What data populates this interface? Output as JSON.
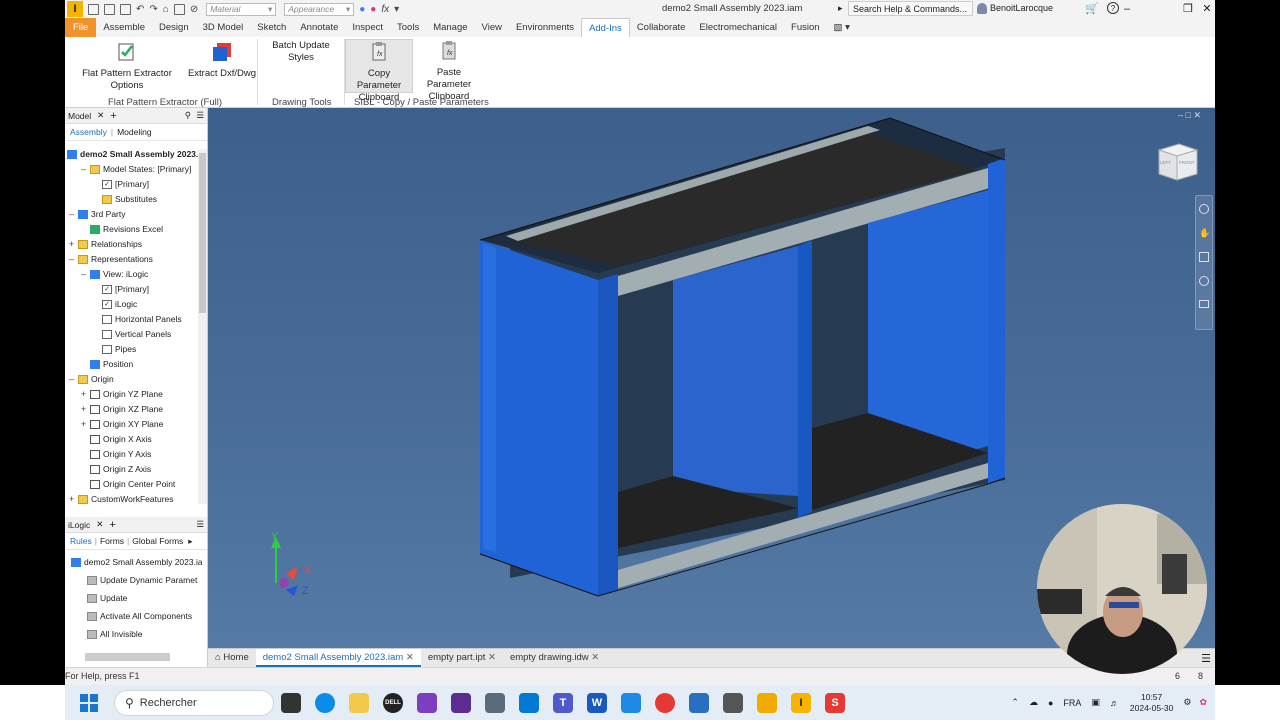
{
  "window": {
    "document_title": "demo2 Small Assembly 2023.iam",
    "search_placeholder": "Search Help & Commands...",
    "user_name": "BenoitLarocque",
    "material_combo": "Material",
    "appearance_combo": "Appearance",
    "minimize": "–",
    "restore": "❐",
    "close": "✕",
    "help": "?"
  },
  "ribbon_tabs": [
    "File",
    "Assemble",
    "Design",
    "3D Model",
    "Sketch",
    "Annotate",
    "Inspect",
    "Tools",
    "Manage",
    "View",
    "Environments",
    "Add-Ins",
    "Collaborate",
    "Electromechanical",
    "Fusion"
  ],
  "ribbon_active_tab": "Add-Ins",
  "ribbon": {
    "flat_pattern_options": "Flat Pattern Extractor Options",
    "extract_dxf": "Extract Dxf/Dwg",
    "batch_update": "Batch Update Styles",
    "copy_param_line1": "Copy Parameter",
    "copy_param_line2": "Clipboard",
    "paste_param_line1": "Paste Parameter",
    "paste_param_line2": "Clipboard",
    "group_flat_pattern": "Flat Pattern Extractor (Full)",
    "group_drawing_tools": "Drawing Tools",
    "group_sibl": "SIBL - Copy / Paste Parameters"
  },
  "browser": {
    "title": "Model",
    "tab_assembly": "Assembly",
    "tab_modeling": "Modeling",
    "root": "demo2 Small Assembly 2023.ia",
    "items": [
      {
        "label": "Model States: [Primary]",
        "indent": 1
      },
      {
        "label": "[Primary]",
        "indent": 2
      },
      {
        "label": "Substitutes",
        "indent": 2
      },
      {
        "label": "3rd Party",
        "indent": 0
      },
      {
        "label": "Revisions Excel",
        "indent": 1
      },
      {
        "label": "Relationships",
        "indent": 0
      },
      {
        "label": "Representations",
        "indent": 0
      },
      {
        "label": "View: iLogic",
        "indent": 1
      },
      {
        "label": "[Primary]",
        "indent": 2
      },
      {
        "label": "iLogic",
        "indent": 2
      },
      {
        "label": "Horizontal Panels",
        "indent": 2
      },
      {
        "label": "Vertical Panels",
        "indent": 2
      },
      {
        "label": "Pipes",
        "indent": 2
      },
      {
        "label": "Position",
        "indent": 1
      },
      {
        "label": "Origin",
        "indent": 0
      },
      {
        "label": "Origin YZ Plane",
        "indent": 1
      },
      {
        "label": "Origin XZ Plane",
        "indent": 1
      },
      {
        "label": "Origin XY Plane",
        "indent": 1
      },
      {
        "label": "Origin X Axis",
        "indent": 1
      },
      {
        "label": "Origin Y Axis",
        "indent": 1
      },
      {
        "label": "Origin Z Axis",
        "indent": 1
      },
      {
        "label": "Origin Center Point",
        "indent": 1
      },
      {
        "label": "CustomWorkFeatures",
        "indent": 0
      }
    ]
  },
  "ilogic": {
    "title": "iLogic",
    "tab_rules": "Rules",
    "tab_forms": "Forms",
    "tab_global_forms": "Global Forms",
    "root": "demo2 Small Assembly 2023.ia",
    "rules": [
      "Update Dynamic Paramet",
      "Update",
      "Activate All Components",
      "All Invisible"
    ]
  },
  "doc_tabs": {
    "home": "Home",
    "tabs": [
      "demo2 Small Assembly 2023.iam",
      "empty part.ipt",
      "empty drawing.idw"
    ],
    "active_index": 0
  },
  "status": {
    "help_text": "For Help, press F1",
    "count_a": "6",
    "count_b": "8"
  },
  "axes": {
    "x": "X",
    "y": "Y",
    "z": "Z"
  },
  "viewcube": {
    "left_face": "LEFT",
    "front_face": "FRONT"
  },
  "taskbar": {
    "search_label": "Rechercher",
    "language": "FRA",
    "time": "10:57",
    "date": "2024-05-30"
  },
  "colors": {
    "viewport_top": "#3d5f8c",
    "panel_blue": "#1f63d6",
    "shelf_gray": "#a3aeb2",
    "accent_file": "#f0932b",
    "active_tab_text": "#1a6fbf"
  }
}
